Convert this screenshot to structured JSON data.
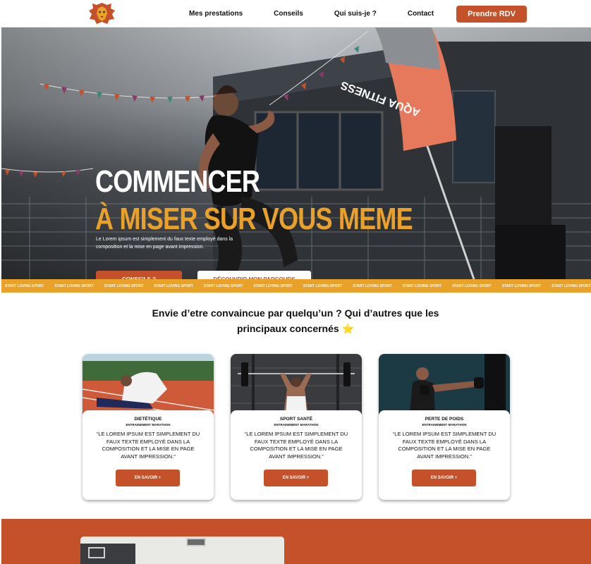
{
  "nav": {
    "logo_icon": "lion-head-logo",
    "links": [
      "Mes prestations",
      "Conseils",
      "Qui suis-je ?",
      "Contact"
    ],
    "cta": "Prendre RDV"
  },
  "hero": {
    "title_line1": "COMMENCER",
    "title_line2": "À MISER SUR VOUS MEME",
    "description": "Le Lorem ipsum est simplement du faux texte employé dans la composition et la mise en page avant impression.",
    "btn_primary": "CONSEILS  ?",
    "btn_secondary": "DÉCOUVRIR MON PARCOURS",
    "banner_text": "AQUA FITNESS"
  },
  "ticker": {
    "text": "START LOVING SPORT",
    "repeat": 15
  },
  "headline": {
    "line1": "Envie d’etre convaincue par quelqu’un ? Qui d’autres que les",
    "line2": "principaux concernés",
    "icon": "star-icon"
  },
  "cards": [
    {
      "title": "DIETÉTIQUE",
      "subtitle": "ENTRAINEMENT MARATHON",
      "quote": "“LE LOREM IPSUM EST SIMPLEMENT DU FAUX TEXTE EMPLOYÉ DANS LA COMPOSITION ET LA MISE EN PAGE AVANT IMPRESSION.”",
      "button": "EN SAVOIR +"
    },
    {
      "title": "SPORT SANTÉ",
      "subtitle": "ENTRAINEMENT MARATHON",
      "quote": "“LE LOREM IPSUM EST SIMPLEMENT DU FAUX TEXTE EMPLOYÉ DANS LA COMPOSITION ET LA MISE EN PAGE AVANT IMPRESSION.”",
      "button": "EN SAVOIR +"
    },
    {
      "title": "PERTE DE POIDS",
      "subtitle": "ENTRAINEMENT MARATHON",
      "quote": "“LE LOREM IPSUM EST SIMPLEMENT DU FAUX TEXTE EMPLOYÉ DANS LA COMPOSITION ET LA MISE EN PAGE AVANT IMPRESSION.”",
      "button": "EN SAVOIR +"
    }
  ],
  "colors": {
    "accent": "#c4512a",
    "highlight": "#eaa12a",
    "text": "#111111"
  }
}
